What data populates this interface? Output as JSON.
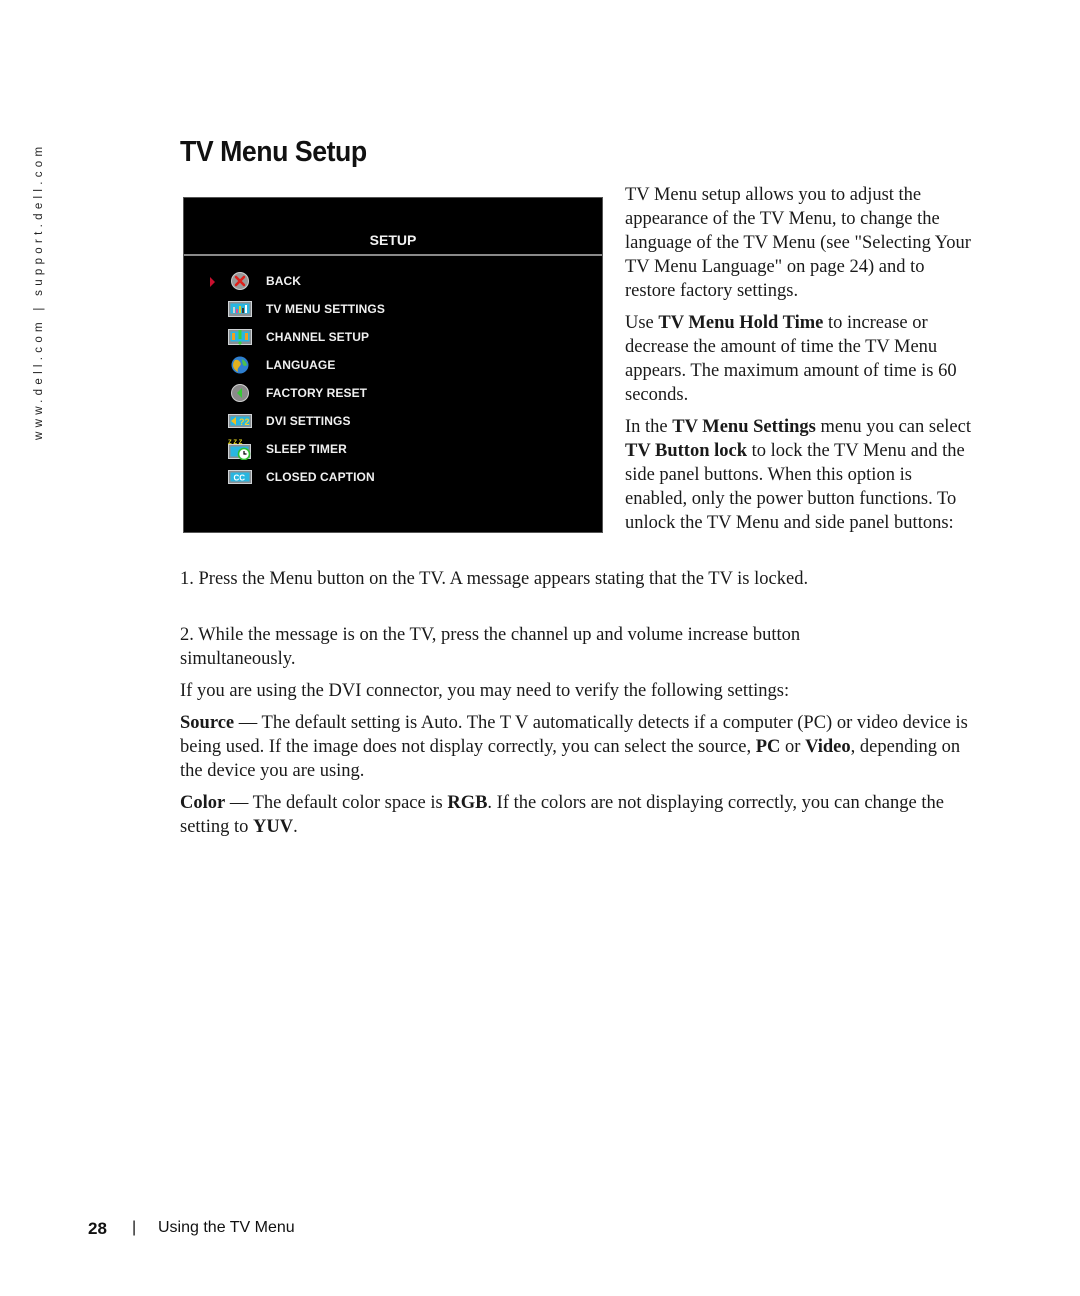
{
  "side_url": "www.dell.com | support.dell.com",
  "page_title": "TV Menu Setup",
  "osd": {
    "header": "SETUP",
    "selected_index": 0,
    "items": [
      {
        "label": "BACK",
        "icon": "back-x-icon"
      },
      {
        "label": "TV MENU SETTINGS",
        "icon": "tv-menu-settings-icon"
      },
      {
        "label": "CHANNEL SETUP",
        "icon": "channel-setup-icon"
      },
      {
        "label": "LANGUAGE",
        "icon": "globe-icon"
      },
      {
        "label": "FACTORY RESET",
        "icon": "factory-reset-icon"
      },
      {
        "label": "DVI SETTINGS",
        "icon": "dvi-settings-icon"
      },
      {
        "label": "SLEEP TIMER",
        "icon": "sleep-timer-icon"
      },
      {
        "label": "CLOSED CAPTION",
        "icon": "closed-caption-icon"
      }
    ],
    "colors": {
      "background": "#000000",
      "text": "#f0f0f0",
      "rule": "#8a8a8a",
      "selector": "#c8102e"
    }
  },
  "right_column": {
    "p1": "TV Menu setup allows you to adjust the appearance of the TV Menu, to change the language of the TV Menu (see \"Selecting Your TV Menu Language\" on page 24) and to restore factory settings.",
    "p2_pre": "Use ",
    "p2_bold": "TV Menu Hold Time",
    "p2_post": " to increase or decrease the amount of time the TV Menu appears. The maximum amount of time is 60 seconds.",
    "p3_pre": "In the ",
    "p3_bold1": "TV Menu Settings",
    "p3_mid": " menu you can select ",
    "p3_bold2": "TV Button lock",
    "p3_post": " to lock the TV Menu and the side panel buttons. When this option is enabled, only the power button functions. To unlock the TV Menu and side panel buttons:"
  },
  "steps": {
    "step1": "1. Press the Menu button on the TV. A message appears stating that the TV is locked.",
    "step2": "2. While the message is on the TV, press the channel up and volume increase button simultaneously."
  },
  "dvi": {
    "intro": "If you are using the DVI connector, you may need to verify the following settings:",
    "source_label": "Source",
    "source_text_1": " — The default setting is Auto. The T V automatically detects if a computer (PC) or video device is being used. If the image does not display correctly, you can select the source, ",
    "source_pc": "PC",
    "source_or": " or ",
    "source_video": "Video",
    "source_text_2": ", depending on the device you are using.",
    "color_label": "Color",
    "color_text_1": " — The default color space is ",
    "color_rgb": "RGB",
    "color_text_2": ". If the colors are not displaying correctly, you can change the setting to ",
    "color_yuv": "YUV",
    "color_text_3": "."
  },
  "footer": {
    "page_number": "28",
    "separator": "|",
    "section": "Using the TV Menu"
  }
}
